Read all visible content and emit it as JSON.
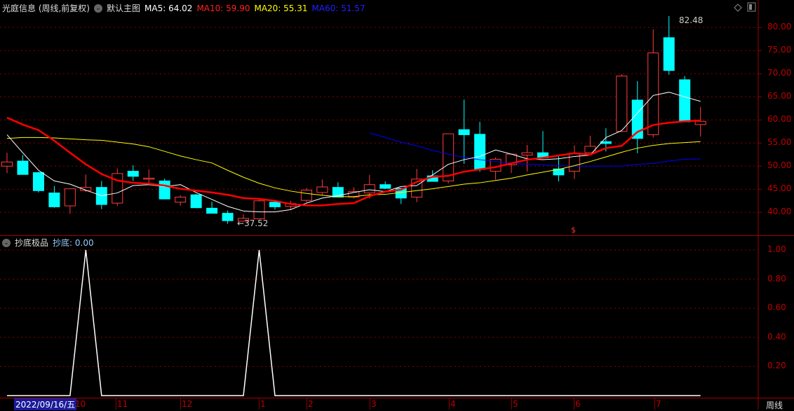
{
  "header": {
    "title": "光庭信息 (周线,前复权)",
    "template": "默认主图",
    "ma": [
      {
        "label": "MA5: 64.02",
        "color": "#ffffff"
      },
      {
        "label": "MA10: 59.90",
        "color": "#ff2020"
      },
      {
        "label": "MA20: 55.31",
        "color": "#ffff00"
      },
      {
        "label": "MA60: 51.57",
        "color": "#2020ff"
      }
    ]
  },
  "window_icons": [
    "diamond-icon",
    "panel-toggle-icon"
  ],
  "indicator_header": {
    "name": "抄底极品",
    "value_label": "抄底: 0.00"
  },
  "price_axis": [
    "80.00",
    "75.00",
    "70.00",
    "65.00",
    "60.00",
    "55.00",
    "50.00",
    "45.00",
    "40.00"
  ],
  "indicator_axis": [
    "1.00",
    "0.80",
    "0.60",
    "0.40",
    "0.20"
  ],
  "x_axis": {
    "selected_date": "2022/09/16/五",
    "labels": [
      "10",
      "11",
      "12",
      "1",
      "2",
      "3",
      "4",
      "5",
      "6",
      "7"
    ],
    "frequency": "周线"
  },
  "annotations": {
    "high": "82.48",
    "low": "37.52",
    "marker": "$"
  },
  "colors": {
    "up": "#ff3b3b",
    "down": "#00ffff",
    "ma5": "#ffffff",
    "ma10": "#ff0000",
    "ma20": "#ffff00",
    "ma60": "#0000ff",
    "grid": "#8b0000"
  },
  "chart_data": {
    "type": "candlestick",
    "ylim": [
      35,
      83
    ],
    "candles": [
      [
        50.0,
        52.9,
        48.5,
        50.9
      ],
      [
        51.1,
        52.4,
        48.2,
        48.2
      ],
      [
        48.6,
        48.8,
        44.3,
        44.7
      ],
      [
        44.2,
        45.7,
        41.0,
        41.2
      ],
      [
        41.4,
        45.2,
        39.7,
        45.1
      ],
      [
        44.7,
        48.2,
        44.4,
        45.4
      ],
      [
        45.4,
        46.8,
        40.7,
        41.7
      ],
      [
        42.0,
        49.5,
        41.4,
        48.4
      ],
      [
        48.9,
        50.2,
        46.8,
        47.8
      ],
      [
        47.2,
        49.3,
        46.1,
        47.4
      ],
      [
        46.8,
        47.3,
        42.9,
        42.9
      ],
      [
        42.2,
        43.7,
        41.4,
        43.3
      ],
      [
        43.8,
        44.0,
        41.0,
        41.0
      ],
      [
        40.9,
        42.3,
        39.8,
        39.8
      ],
      [
        39.8,
        40.4,
        37.52,
        38.2
      ],
      [
        38.1,
        39.6,
        38.0,
        38.7
      ],
      [
        38.6,
        43.0,
        38.6,
        42.5
      ],
      [
        42.2,
        42.7,
        40.6,
        41.2
      ],
      [
        41.3,
        42.5,
        40.6,
        41.9
      ],
      [
        42.6,
        45.3,
        42.2,
        44.8
      ],
      [
        44.3,
        47.1,
        43.6,
        45.5
      ],
      [
        45.4,
        46.5,
        43.3,
        43.3
      ],
      [
        43.3,
        45.4,
        43.0,
        44.5
      ],
      [
        44.2,
        48.1,
        43.0,
        46.0
      ],
      [
        46.0,
        46.7,
        45.0,
        45.2
      ],
      [
        45.2,
        45.2,
        41.8,
        43.1
      ],
      [
        43.3,
        49.4,
        42.2,
        47.2
      ],
      [
        47.9,
        49.1,
        46.7,
        46.7
      ],
      [
        46.8,
        57.0,
        46.3,
        57.0
      ],
      [
        57.9,
        64.4,
        50.5,
        56.8
      ],
      [
        56.9,
        59.6,
        48.8,
        49.3
      ],
      [
        48.9,
        51.9,
        47.1,
        51.5
      ],
      [
        50.3,
        52.6,
        48.5,
        52.6
      ],
      [
        52.4,
        54.6,
        48.8,
        52.9
      ],
      [
        52.9,
        57.6,
        51.8,
        51.8
      ],
      [
        49.4,
        52.4,
        46.7,
        48.1
      ],
      [
        48.9,
        54.5,
        47.2,
        52.8
      ],
      [
        52.9,
        56.6,
        52.9,
        54.3
      ],
      [
        55.3,
        58.2,
        53.2,
        54.9
      ],
      [
        57.5,
        69.9,
        57.5,
        69.5
      ],
      [
        64.3,
        68.4,
        52.8,
        56.0
      ],
      [
        56.8,
        79.6,
        56.2,
        74.5
      ],
      [
        77.8,
        82.48,
        69.8,
        70.7
      ],
      [
        68.7,
        69.5,
        59.6,
        59.6
      ],
      [
        59.0,
        62.8,
        56.4,
        59.7
      ]
    ],
    "candle_fields": [
      "open",
      "high",
      "low",
      "close"
    ],
    "ma5": [
      56.8,
      52.9,
      49.1,
      46.8,
      46.1,
      44.8,
      43.6,
      44.2,
      45.8,
      46.0,
      45.6,
      46.0,
      44.3,
      42.8,
      41.3,
      40.3,
      40.1,
      40.1,
      40.6,
      42.0,
      43.1,
      43.6,
      44.3,
      44.9,
      44.5,
      45.6,
      45.8,
      48.1,
      50.4,
      51.4,
      52.1,
      53.5,
      52.6,
      51.6,
      51.4,
      51.6,
      52.1,
      52.4,
      56.2,
      57.7,
      61.5,
      65.3,
      66.0,
      65.0,
      64.02
    ],
    "ma10": [
      60.5,
      59.0,
      57.8,
      55.5,
      52.9,
      50.4,
      48.3,
      46.9,
      46.4,
      46.2,
      45.8,
      45.1,
      44.7,
      44.3,
      43.8,
      43.1,
      42.9,
      42.5,
      41.8,
      41.5,
      41.5,
      41.8,
      42.0,
      43.5,
      44.5,
      44.9,
      46.6,
      47.7,
      47.9,
      48.8,
      49.3,
      49.8,
      50.6,
      51.4,
      51.8,
      52.3,
      52.8,
      52.5,
      53.9,
      54.4,
      57.4,
      58.9,
      59.4,
      59.7,
      59.9
    ],
    "ma20": [
      56.0,
      56.2,
      56.2,
      56.1,
      55.9,
      55.7,
      55.6,
      55.2,
      54.8,
      54.2,
      53.2,
      52.2,
      51.4,
      50.7,
      49.1,
      47.6,
      46.3,
      45.3,
      44.6,
      44.1,
      43.7,
      43.4,
      43.4,
      43.8,
      43.9,
      44.3,
      44.7,
      45.1,
      45.6,
      46.1,
      46.4,
      46.9,
      47.4,
      48.1,
      48.7,
      49.3,
      50.1,
      51.0,
      52.0,
      53.0,
      53.9,
      54.5,
      54.9,
      55.1,
      55.31
    ],
    "ma60_start_index": 23,
    "ma60": [
      57.2,
      56.2,
      55.2,
      54.4,
      53.4,
      52.6,
      51.9,
      51.4,
      51.0,
      50.6,
      50.4,
      50.3,
      50.1,
      50.0,
      50.0,
      50.0,
      50.0,
      50.4,
      50.6,
      51.1,
      51.5,
      51.57
    ],
    "indicator": {
      "name": "抄底",
      "ylim": [
        0,
        1
      ],
      "values": [
        0,
        0,
        0,
        0,
        0,
        1,
        0,
        0,
        0,
        0,
        0,
        0,
        0,
        0,
        0,
        0,
        1,
        0,
        0,
        0,
        0,
        0,
        0,
        0,
        0,
        0,
        0,
        0,
        0,
        0,
        0,
        0,
        0,
        0,
        0,
        0,
        0,
        0,
        0,
        0,
        0,
        0,
        0,
        0,
        0
      ]
    }
  }
}
